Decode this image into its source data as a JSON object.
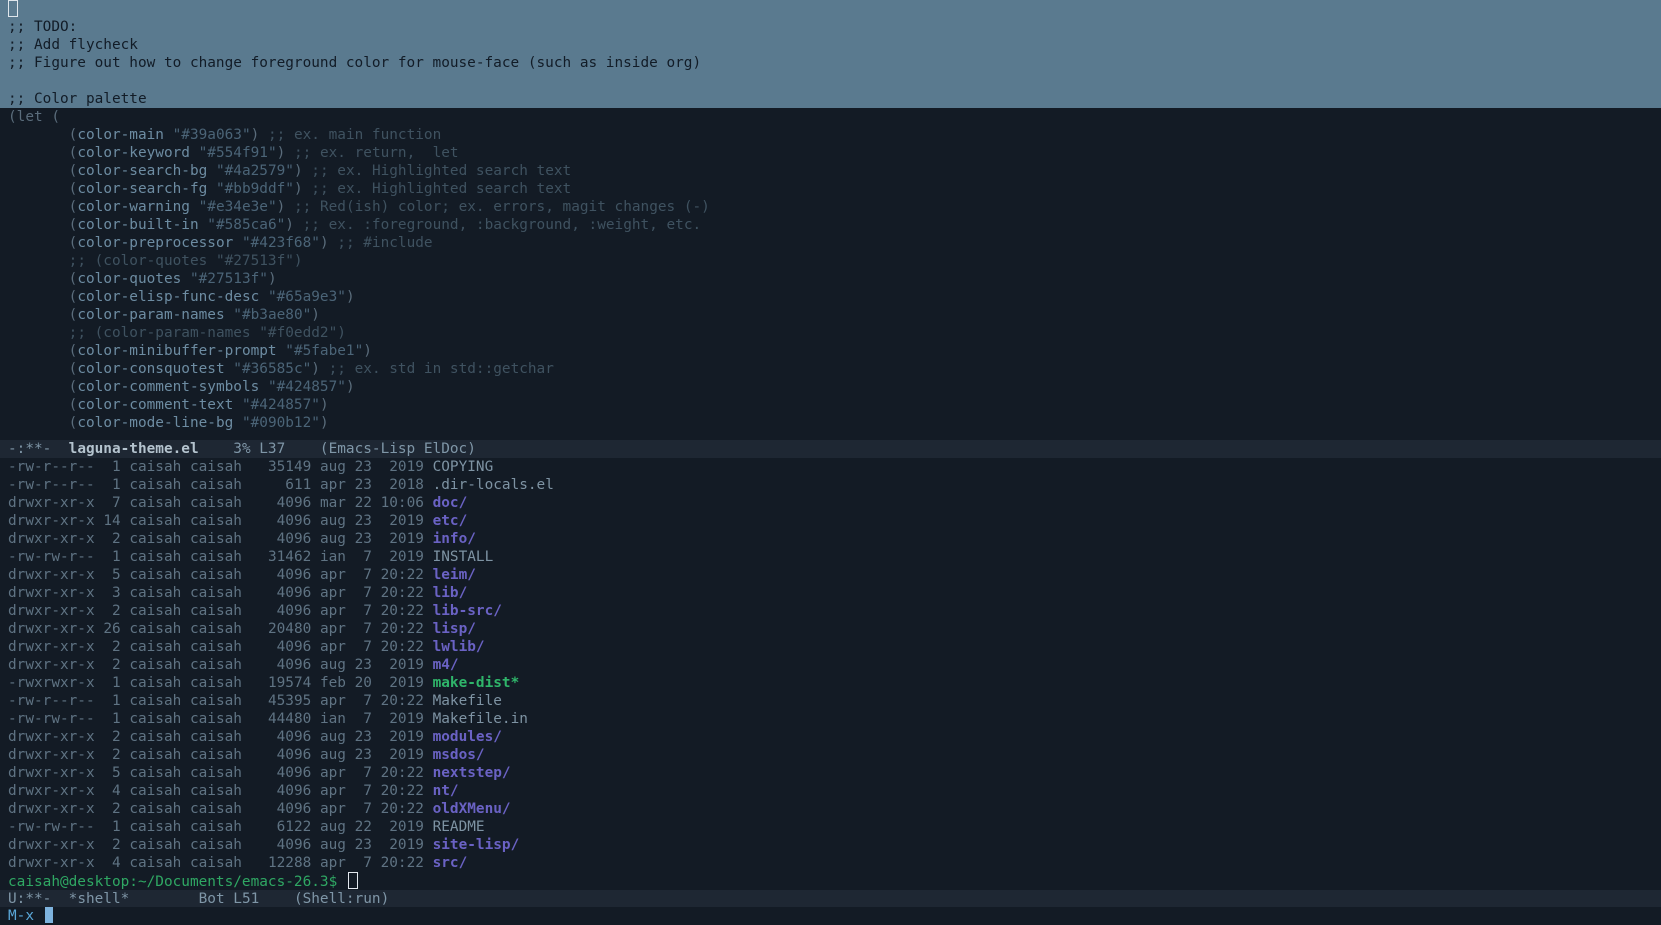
{
  "editor": {
    "cursor_glyph": "",
    "selected_lines": [
      "",
      ";; TODO:",
      ";; Add flycheck",
      ";; Figure out how to change foreground color for mouse-face (such as inside org)",
      "",
      ";; Color palette"
    ],
    "let_open": "(let (",
    "bindings": [
      {
        "sym": "color-main",
        "val": "\"#39a063\"",
        "comment": ";; ex. main function",
        "commented": false
      },
      {
        "sym": "color-keyword",
        "val": "\"#554f91\"",
        "comment": ";; ex. return,  let",
        "commented": false
      },
      {
        "sym": "color-search-bg",
        "val": "\"#4a2579\"",
        "comment": ";; ex. Highlighted search text",
        "commented": false
      },
      {
        "sym": "color-search-fg",
        "val": "\"#bb9ddf\"",
        "comment": ";; ex. Highlighted search text",
        "commented": false
      },
      {
        "sym": "color-warning",
        "val": "\"#e34e3e\"",
        "comment": ";; Red(ish) color; ex. errors, magit changes (-)",
        "commented": false
      },
      {
        "sym": "color-built-in",
        "val": "\"#585ca6\"",
        "comment": ";; ex. :foreground, :background, :weight, etc.",
        "commented": false
      },
      {
        "sym": "color-preprocessor",
        "val": "\"#423f68\"",
        "comment": ";; #include",
        "commented": false
      },
      {
        "sym": "",
        "val": "",
        "comment": ";; (color-quotes \"#27513f\")",
        "commented": true
      },
      {
        "sym": "color-quotes",
        "val": "\"#27513f\"",
        "comment": "",
        "commented": false
      },
      {
        "sym": "color-elisp-func-desc",
        "val": "\"#65a9e3\"",
        "comment": "",
        "commented": false
      },
      {
        "sym": "color-param-names",
        "val": "\"#b3ae80\"",
        "comment": "",
        "commented": false
      },
      {
        "sym": "",
        "val": "",
        "comment": ";; (color-param-names \"#f0edd2\")",
        "commented": true
      },
      {
        "sym": "color-minibuffer-prompt",
        "val": "\"#5fabe1\"",
        "comment": "",
        "commented": false
      },
      {
        "sym": "color-consquotest",
        "val": "\"#36585c\"",
        "comment": ";; ex. std in std::getchar",
        "commented": false
      },
      {
        "sym": "color-comment-symbols",
        "val": "\"#424857\"",
        "comment": "",
        "commented": false
      },
      {
        "sym": "color-comment-text",
        "val": "\"#424857\"",
        "comment": "",
        "commented": false
      },
      {
        "sym": "color-mode-line-bg",
        "val": "\"#090b12\"",
        "comment": "",
        "commented": false
      }
    ]
  },
  "modeline_top": {
    "status": "-:**-  ",
    "buffer": "laguna-theme.el",
    "position": "    3% L37    ",
    "modes": "(Emacs-Lisp ElDoc)"
  },
  "shell": {
    "listing": [
      {
        "perm": "-rw-r--r--",
        "links": " 1",
        "owner": "caisah",
        "group": "caisah",
        "size": "35149",
        "date": "aug 23  2019",
        "name": "COPYING",
        "kind": "file"
      },
      {
        "perm": "-rw-r--r--",
        "links": " 1",
        "owner": "caisah",
        "group": "caisah",
        "size": "  611",
        "date": "apr 23  2018",
        "name": ".dir-locals.el",
        "kind": "file"
      },
      {
        "perm": "drwxr-xr-x",
        "links": " 7",
        "owner": "caisah",
        "group": "caisah",
        "size": " 4096",
        "date": "mar 22 10:06",
        "name": "doc/",
        "kind": "dir"
      },
      {
        "perm": "drwxr-xr-x",
        "links": "14",
        "owner": "caisah",
        "group": "caisah",
        "size": " 4096",
        "date": "aug 23  2019",
        "name": "etc/",
        "kind": "dir"
      },
      {
        "perm": "drwxr-xr-x",
        "links": " 2",
        "owner": "caisah",
        "group": "caisah",
        "size": " 4096",
        "date": "aug 23  2019",
        "name": "info/",
        "kind": "dir"
      },
      {
        "perm": "-rw-rw-r--",
        "links": " 1",
        "owner": "caisah",
        "group": "caisah",
        "size": "31462",
        "date": "ian  7  2019",
        "name": "INSTALL",
        "kind": "file"
      },
      {
        "perm": "drwxr-xr-x",
        "links": " 5",
        "owner": "caisah",
        "group": "caisah",
        "size": " 4096",
        "date": "apr  7 20:22",
        "name": "leim/",
        "kind": "dir"
      },
      {
        "perm": "drwxr-xr-x",
        "links": " 3",
        "owner": "caisah",
        "group": "caisah",
        "size": " 4096",
        "date": "apr  7 20:22",
        "name": "lib/",
        "kind": "dir"
      },
      {
        "perm": "drwxr-xr-x",
        "links": " 2",
        "owner": "caisah",
        "group": "caisah",
        "size": " 4096",
        "date": "apr  7 20:22",
        "name": "lib-src/",
        "kind": "dir"
      },
      {
        "perm": "drwxr-xr-x",
        "links": "26",
        "owner": "caisah",
        "group": "caisah",
        "size": "20480",
        "date": "apr  7 20:22",
        "name": "lisp/",
        "kind": "dir"
      },
      {
        "perm": "drwxr-xr-x",
        "links": " 2",
        "owner": "caisah",
        "group": "caisah",
        "size": " 4096",
        "date": "apr  7 20:22",
        "name": "lwlib/",
        "kind": "dir"
      },
      {
        "perm": "drwxr-xr-x",
        "links": " 2",
        "owner": "caisah",
        "group": "caisah",
        "size": " 4096",
        "date": "aug 23  2019",
        "name": "m4/",
        "kind": "dir"
      },
      {
        "perm": "-rwxrwxr-x",
        "links": " 1",
        "owner": "caisah",
        "group": "caisah",
        "size": "19574",
        "date": "feb 20  2019",
        "name": "make-dist*",
        "kind": "exec"
      },
      {
        "perm": "-rw-r--r--",
        "links": " 1",
        "owner": "caisah",
        "group": "caisah",
        "size": "45395",
        "date": "apr  7 20:22",
        "name": "Makefile",
        "kind": "file"
      },
      {
        "perm": "-rw-rw-r--",
        "links": " 1",
        "owner": "caisah",
        "group": "caisah",
        "size": "44480",
        "date": "ian  7  2019",
        "name": "Makefile.in",
        "kind": "file"
      },
      {
        "perm": "drwxr-xr-x",
        "links": " 2",
        "owner": "caisah",
        "group": "caisah",
        "size": " 4096",
        "date": "aug 23  2019",
        "name": "modules/",
        "kind": "dir"
      },
      {
        "perm": "drwxr-xr-x",
        "links": " 2",
        "owner": "caisah",
        "group": "caisah",
        "size": " 4096",
        "date": "aug 23  2019",
        "name": "msdos/",
        "kind": "dir"
      },
      {
        "perm": "drwxr-xr-x",
        "links": " 5",
        "owner": "caisah",
        "group": "caisah",
        "size": " 4096",
        "date": "apr  7 20:22",
        "name": "nextstep/",
        "kind": "dir"
      },
      {
        "perm": "drwxr-xr-x",
        "links": " 4",
        "owner": "caisah",
        "group": "caisah",
        "size": " 4096",
        "date": "apr  7 20:22",
        "name": "nt/",
        "kind": "dir"
      },
      {
        "perm": "drwxr-xr-x",
        "links": " 2",
        "owner": "caisah",
        "group": "caisah",
        "size": " 4096",
        "date": "apr  7 20:22",
        "name": "oldXMenu/",
        "kind": "dir"
      },
      {
        "perm": "-rw-rw-r--",
        "links": " 1",
        "owner": "caisah",
        "group": "caisah",
        "size": " 6122",
        "date": "aug 22  2019",
        "name": "README",
        "kind": "file"
      },
      {
        "perm": "drwxr-xr-x",
        "links": " 2",
        "owner": "caisah",
        "group": "caisah",
        "size": " 4096",
        "date": "aug 23  2019",
        "name": "site-lisp/",
        "kind": "dir"
      },
      {
        "perm": "drwxr-xr-x",
        "links": " 4",
        "owner": "caisah",
        "group": "caisah",
        "size": "12288",
        "date": "apr  7 20:22",
        "name": "src/",
        "kind": "dir"
      }
    ],
    "prompt": "caisah@desktop:~/Documents/emacs-26.3$ "
  },
  "modeline_bottom": {
    "status": "U:**-  ",
    "buffer": "*shell*",
    "position": "        Bot L51    ",
    "modes": "(Shell:run)"
  },
  "minibuffer": {
    "text": "M-x "
  },
  "colors": {
    "background": "#131b25",
    "selection": "#5a7a8f",
    "directory": "#6a62c4",
    "executable": "#2fb56a",
    "prompt": "#2fa763",
    "minibuffer_prompt": "#5aa7d8"
  }
}
